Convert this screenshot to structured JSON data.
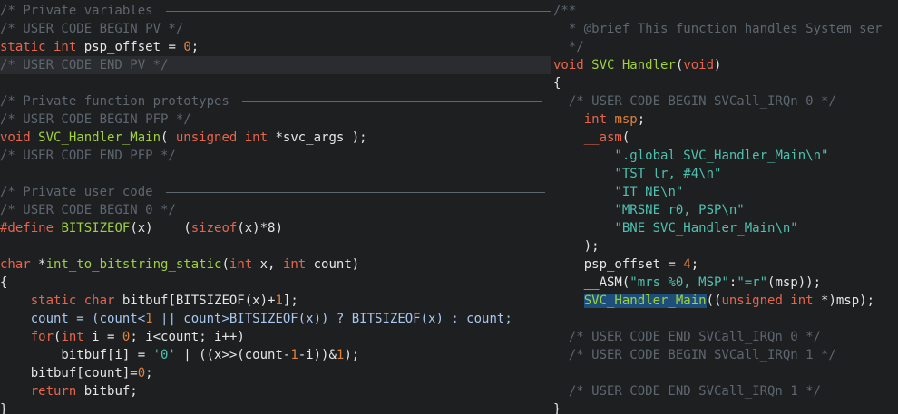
{
  "left_pane": {
    "lines": [
      {
        "tokens": [
          {
            "t": "/* Private variables ",
            "c": "c"
          }
        ],
        "rule": 425
      },
      {
        "tokens": [
          {
            "t": "/* USER CODE BEGIN PV */",
            "c": "c"
          }
        ]
      },
      {
        "tokens": [
          {
            "t": "static int",
            "c": "k"
          },
          {
            "t": " psp_offset = ",
            "c": "p"
          },
          {
            "t": "0",
            "c": "n"
          },
          {
            "t": ";",
            "c": "p"
          }
        ]
      },
      {
        "tokens": [
          {
            "t": "/* USER CODE END PV */",
            "c": "c"
          }
        ],
        "highlight": true
      },
      {
        "tokens": []
      },
      {
        "tokens": [
          {
            "t": "/* Private function prototypes ",
            "c": "c"
          }
        ],
        "rule": 330
      },
      {
        "tokens": [
          {
            "t": "/* USER CODE BEGIN PFP */",
            "c": "c"
          }
        ]
      },
      {
        "tokens": [
          {
            "t": "void",
            "c": "k"
          },
          {
            "t": " ",
            "c": "p"
          },
          {
            "t": "SVC_Handler_Main",
            "c": "f"
          },
          {
            "t": "( ",
            "c": "p"
          },
          {
            "t": "unsigned int",
            "c": "k"
          },
          {
            "t": " *svc_args );",
            "c": "p"
          }
        ]
      },
      {
        "tokens": [
          {
            "t": "/* USER CODE END PFP */",
            "c": "c"
          }
        ]
      },
      {
        "tokens": []
      },
      {
        "tokens": [
          {
            "t": "/* Private user code ",
            "c": "c"
          }
        ],
        "rule": 418
      },
      {
        "tokens": [
          {
            "t": "/* USER CODE BEGIN 0 */",
            "c": "c"
          }
        ]
      },
      {
        "tokens": [
          {
            "t": "#define",
            "c": "k"
          },
          {
            "t": " ",
            "c": "p"
          },
          {
            "t": "BITSIZEOF",
            "c": "f"
          },
          {
            "t": "(x)    (",
            "c": "p"
          },
          {
            "t": "sizeof",
            "c": "k"
          },
          {
            "t": "(x)*8)",
            "c": "p"
          }
        ]
      },
      {
        "tokens": []
      },
      {
        "tokens": [
          {
            "t": "char",
            "c": "k"
          },
          {
            "t": " *",
            "c": "p"
          },
          {
            "t": "int_to_bitstring_static",
            "c": "f"
          },
          {
            "t": "(",
            "c": "p"
          },
          {
            "t": "int",
            "c": "k"
          },
          {
            "t": " x, ",
            "c": "p"
          },
          {
            "t": "int",
            "c": "k"
          },
          {
            "t": " count)",
            "c": "p"
          }
        ]
      },
      {
        "tokens": [
          {
            "t": "{",
            "c": "p"
          }
        ]
      },
      {
        "tokens": [
          {
            "t": "    ",
            "c": "p"
          },
          {
            "t": "static char",
            "c": "k"
          },
          {
            "t": " bitbuf[BITSIZEOF(x)+",
            "c": "p"
          },
          {
            "t": "1",
            "c": "n"
          },
          {
            "t": "];",
            "c": "p"
          }
        ]
      },
      {
        "tokens": [
          {
            "t": "    count = (count<",
            "c": "p2"
          },
          {
            "t": "1",
            "c": "n"
          },
          {
            "t": " || count>BITSIZEOF(x)) ? BITSIZEOF(x) : count;",
            "c": "p2"
          }
        ]
      },
      {
        "tokens": [
          {
            "t": "    ",
            "c": "p"
          },
          {
            "t": "for",
            "c": "k"
          },
          {
            "t": "(",
            "c": "p"
          },
          {
            "t": "int",
            "c": "k"
          },
          {
            "t": " i = ",
            "c": "p"
          },
          {
            "t": "0",
            "c": "n"
          },
          {
            "t": "; i<count; i++)",
            "c": "p"
          }
        ]
      },
      {
        "tokens": [
          {
            "t": "        bitbuf[i] = ",
            "c": "p"
          },
          {
            "t": "'0'",
            "c": "s"
          },
          {
            "t": " | ((x>>(count-",
            "c": "p"
          },
          {
            "t": "1",
            "c": "n"
          },
          {
            "t": "-i))&",
            "c": "p"
          },
          {
            "t": "1",
            "c": "n"
          },
          {
            "t": ");",
            "c": "p"
          }
        ]
      },
      {
        "tokens": [
          {
            "t": "    bitbuf[count]=",
            "c": "p"
          },
          {
            "t": "0",
            "c": "n"
          },
          {
            "t": ";",
            "c": "p"
          }
        ]
      },
      {
        "tokens": [
          {
            "t": "    ",
            "c": "p"
          },
          {
            "t": "return",
            "c": "k"
          },
          {
            "t": " bitbuf;",
            "c": "p"
          }
        ]
      },
      {
        "tokens": [
          {
            "t": "}",
            "c": "p"
          }
        ]
      }
    ]
  },
  "right_pane": {
    "lines": [
      {
        "tokens": [
          {
            "t": "/**",
            "c": "c"
          }
        ]
      },
      {
        "tokens": [
          {
            "t": "  * @brief This function handles System ser",
            "c": "c"
          }
        ]
      },
      {
        "tokens": [
          {
            "t": "  */",
            "c": "c"
          }
        ]
      },
      {
        "tokens": [
          {
            "t": "void",
            "c": "k"
          },
          {
            "t": " ",
            "c": "p"
          },
          {
            "t": "SVC_Handler",
            "c": "f"
          },
          {
            "t": "(",
            "c": "p"
          },
          {
            "t": "void",
            "c": "k"
          },
          {
            "t": ")",
            "c": "p"
          }
        ]
      },
      {
        "tokens": [
          {
            "t": "{",
            "c": "p"
          }
        ]
      },
      {
        "tokens": [
          {
            "t": "  /* USER CODE BEGIN SVCall_IRQn 0 */",
            "c": "c"
          }
        ]
      },
      {
        "tokens": [
          {
            "t": "    ",
            "c": "p"
          },
          {
            "t": "int",
            "c": "k"
          },
          {
            "t": " ",
            "c": "p"
          },
          {
            "t": "msp",
            "c": "n"
          },
          {
            "t": ";",
            "c": "p"
          }
        ]
      },
      {
        "tokens": [
          {
            "t": "    ",
            "c": "p"
          },
          {
            "t": "__asm",
            "c": "k"
          },
          {
            "t": "(",
            "c": "p"
          }
        ]
      },
      {
        "tokens": [
          {
            "t": "        ",
            "c": "p"
          },
          {
            "t": "\".global SVC_Handler_Main\\n\"",
            "c": "s"
          }
        ]
      },
      {
        "tokens": [
          {
            "t": "        ",
            "c": "p"
          },
          {
            "t": "\"TST lr, #4\\n\"",
            "c": "s"
          }
        ]
      },
      {
        "tokens": [
          {
            "t": "        ",
            "c": "p"
          },
          {
            "t": "\"IT NE\\n\"",
            "c": "s"
          }
        ]
      },
      {
        "tokens": [
          {
            "t": "        ",
            "c": "p"
          },
          {
            "t": "\"MRSNE r0, PSP\\n\"",
            "c": "s"
          }
        ]
      },
      {
        "tokens": [
          {
            "t": "        ",
            "c": "p"
          },
          {
            "t": "\"BNE SVC_Handler_Main\\n\"",
            "c": "s"
          }
        ]
      },
      {
        "tokens": [
          {
            "t": "    );",
            "c": "p"
          }
        ]
      },
      {
        "tokens": [
          {
            "t": "    psp_offset = ",
            "c": "p"
          },
          {
            "t": "4",
            "c": "n"
          },
          {
            "t": ";",
            "c": "p"
          }
        ]
      },
      {
        "tokens": [
          {
            "t": "    __ASM(",
            "c": "p"
          },
          {
            "t": "\"mrs %0, MSP\"",
            "c": "s"
          },
          {
            "t": ":",
            "c": "p"
          },
          {
            "t": "\"=r\"",
            "c": "s"
          },
          {
            "t": "(msp));",
            "c": "p"
          }
        ]
      },
      {
        "tokens": [
          {
            "t": "    ",
            "c": "p"
          },
          {
            "t": "SVC_Handler_Main",
            "c": "sel"
          },
          {
            "t": "((",
            "c": "p"
          },
          {
            "t": "unsigned int",
            "c": "k"
          },
          {
            "t": " *)msp);",
            "c": "p"
          }
        ]
      },
      {
        "tokens": []
      },
      {
        "tokens": [
          {
            "t": "  /* USER CODE END SVCall_IRQn 0 */",
            "c": "c"
          }
        ]
      },
      {
        "tokens": [
          {
            "t": "  /* USER CODE BEGIN SVCall_IRQn 1 */",
            "c": "c"
          }
        ]
      },
      {
        "tokens": []
      },
      {
        "tokens": [
          {
            "t": "  /* USER CODE END SVCall_IRQn 1 */",
            "c": "c"
          }
        ]
      },
      {
        "tokens": [
          {
            "t": "}",
            "c": "p"
          }
        ]
      }
    ]
  },
  "colors": {
    "background": "#1d1f21",
    "comment": "#5e6670",
    "keyword": "#e8654d",
    "function": "#9fd13f",
    "string": "#4fc1b0",
    "number": "#e0813a",
    "selection": "#1d4f7a",
    "current_line": "#2a2c2f"
  }
}
